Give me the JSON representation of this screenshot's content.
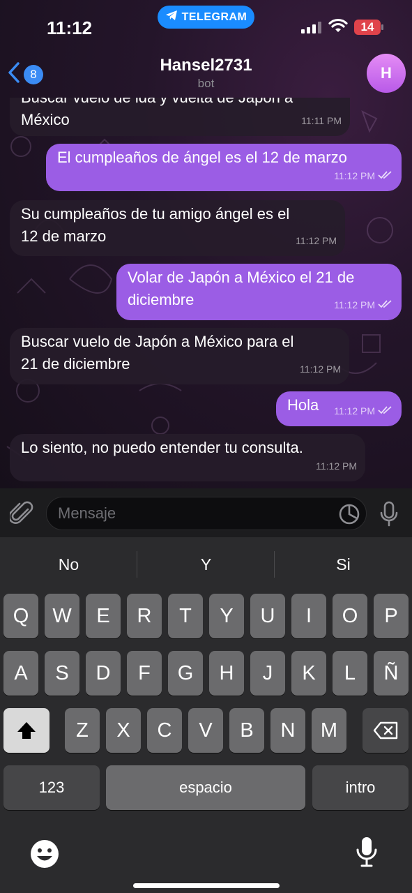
{
  "status": {
    "time": "11:12",
    "pill_label": "TELEGRAM",
    "battery": "14"
  },
  "header": {
    "back_count": "8",
    "title": "Hansel2731",
    "subtitle": "bot",
    "avatar_letter": "H"
  },
  "messages": [
    {
      "dir": "in",
      "lines": [
        "Buscar vuelo de ida y vuelta de Japón a",
        "México"
      ],
      "time": "11:11 PM"
    },
    {
      "dir": "out",
      "lines": [
        "El cumpleaños de ángel es el 12 de marzo"
      ],
      "time": "11:12 PM"
    },
    {
      "dir": "in",
      "lines": [
        "Su cumpleaños de tu amigo ángel es el",
        "12 de marzo"
      ],
      "time": "11:12 PM"
    },
    {
      "dir": "out",
      "lines": [
        "Volar de Japón a México el 21 de",
        "diciembre"
      ],
      "time": "11:12 PM"
    },
    {
      "dir": "in",
      "lines": [
        "Buscar vuelo de Japón a México para el",
        "21 de diciembre"
      ],
      "time": "11:12 PM"
    },
    {
      "dir": "out",
      "lines": [
        "Hola"
      ],
      "time": "11:12 PM"
    },
    {
      "dir": "in",
      "lines": [
        "Lo siento, no puedo entender tu consulta."
      ],
      "time": "11:12 PM"
    }
  ],
  "input": {
    "placeholder": "Mensaje"
  },
  "keyboard": {
    "suggestions": [
      "No",
      "Y",
      "Si"
    ],
    "row1": [
      "Q",
      "W",
      "E",
      "R",
      "T",
      "Y",
      "U",
      "I",
      "O",
      "P"
    ],
    "row2": [
      "A",
      "S",
      "D",
      "F",
      "G",
      "H",
      "J",
      "K",
      "L",
      "Ñ"
    ],
    "row3": [
      "Z",
      "X",
      "C",
      "V",
      "B",
      "N",
      "M"
    ],
    "numbers_label": "123",
    "space_label": "espacio",
    "return_label": "intro"
  },
  "colors": {
    "outgoing_bubble": "#9b5de5",
    "incoming_bubble": "#261c2a",
    "accent": "#3b8cf5",
    "battery_low": "#e0434b"
  },
  "icons": [
    "telegram-icon",
    "back-chevron-icon",
    "attach-icon",
    "sticker-icon",
    "microphone-icon",
    "shift-icon",
    "backspace-icon",
    "emoji-icon",
    "dictation-icon",
    "read-checkmarks-icon"
  ]
}
